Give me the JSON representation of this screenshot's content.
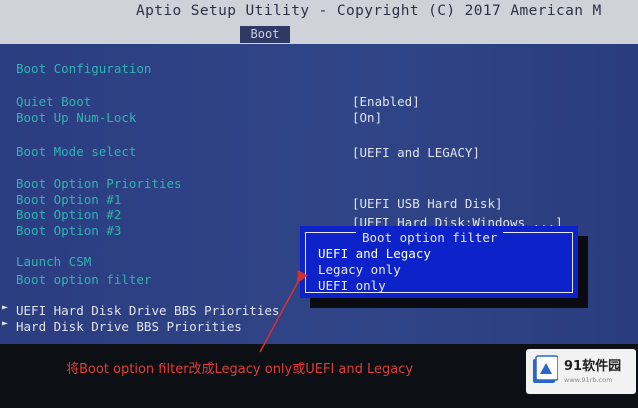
{
  "header": {
    "title": "Aptio Setup Utility - Copyright (C) 2017 American M",
    "active_tab": "Boot"
  },
  "boot": {
    "section_title": "Boot Configuration",
    "quiet_boot": {
      "label": "Quiet Boot",
      "value": "[Enabled]"
    },
    "numlock": {
      "label": "Boot Up Num-Lock",
      "value": "[On]"
    },
    "boot_mode": {
      "label": "Boot Mode select",
      "value": "[UEFI and LEGACY]"
    },
    "priorities_title": "Boot Option Priorities",
    "options": [
      {
        "label": "Boot Option #1",
        "value": "[UEFI USB Hard Disk]"
      },
      {
        "label": "Boot Option #2",
        "value": "[UEFI Hard Disk:Windows ...]"
      },
      {
        "label": "Boot Option #3",
        "value": ""
      }
    ],
    "launch_csm": "Launch CSM",
    "boot_option_filter": "Boot option filter",
    "submenus": [
      "UEFI Hard Disk Drive BBS Priorities",
      "Hard Disk Drive BBS Priorities"
    ]
  },
  "popup": {
    "title": "Boot option filter",
    "options": [
      "UEFI and Legacy",
      "Legacy only",
      "UEFI only"
    ],
    "selected_index": 0
  },
  "caption": "将Boot option filter改成Legacy only或UEFI and Legacy",
  "watermark": {
    "brand": "91软件园",
    "url": "www.91rb.com"
  },
  "colors": {
    "header_bg": "#cfd3d9",
    "panel_bg": "#304587",
    "label_cyan": "#2fb4b4",
    "popup_bg": "#0d23c9",
    "caption_red": "#e23a3a"
  }
}
